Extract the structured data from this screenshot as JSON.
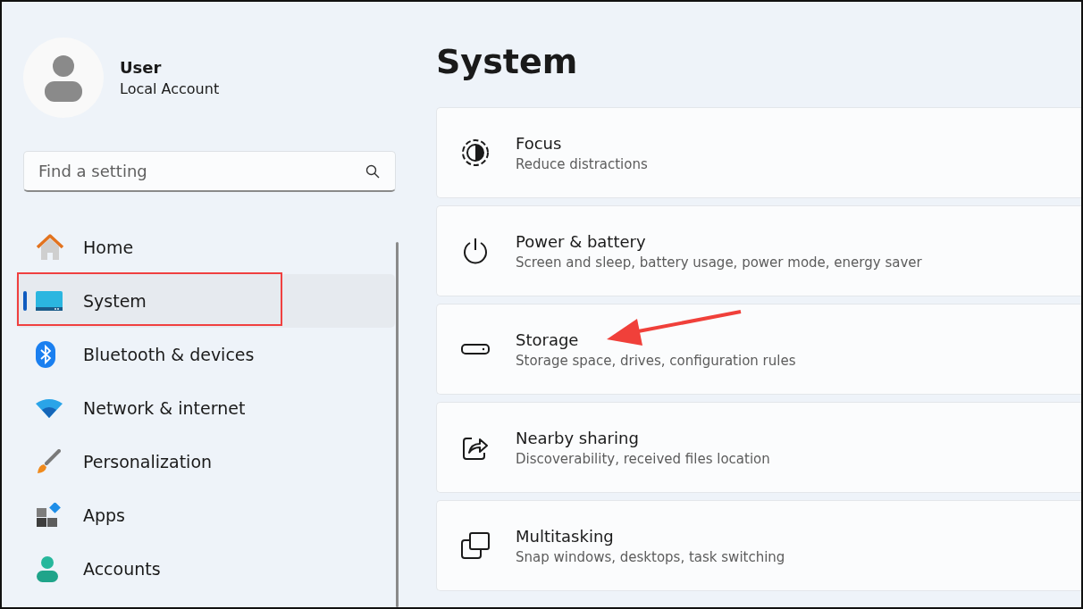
{
  "account": {
    "name": "User",
    "type": "Local Account"
  },
  "search": {
    "placeholder": "Find a setting"
  },
  "nav": [
    {
      "label": "Home",
      "kind": "home",
      "selected": false,
      "highlighted": false
    },
    {
      "label": "System",
      "kind": "system",
      "selected": true,
      "highlighted": true
    },
    {
      "label": "Bluetooth & devices",
      "kind": "bluetooth",
      "selected": false,
      "highlighted": false
    },
    {
      "label": "Network & internet",
      "kind": "network",
      "selected": false,
      "highlighted": false
    },
    {
      "label": "Personalization",
      "kind": "personalization",
      "selected": false,
      "highlighted": false
    },
    {
      "label": "Apps",
      "kind": "apps",
      "selected": false,
      "highlighted": false
    },
    {
      "label": "Accounts",
      "kind": "accounts",
      "selected": false,
      "highlighted": false
    }
  ],
  "page_title": "System",
  "cards": [
    {
      "title": "Focus",
      "subtitle": "Reduce distractions",
      "kind": "focus",
      "pointed": false
    },
    {
      "title": "Power & battery",
      "subtitle": "Screen and sleep, battery usage, power mode, energy saver",
      "kind": "power",
      "pointed": false
    },
    {
      "title": "Storage",
      "subtitle": "Storage space, drives, configuration rules",
      "kind": "storage",
      "pointed": true
    },
    {
      "title": "Nearby sharing",
      "subtitle": "Discoverability, received files location",
      "kind": "sharing",
      "pointed": false
    },
    {
      "title": "Multitasking",
      "subtitle": "Snap windows, desktops, task switching",
      "kind": "multitasking",
      "pointed": false
    }
  ]
}
